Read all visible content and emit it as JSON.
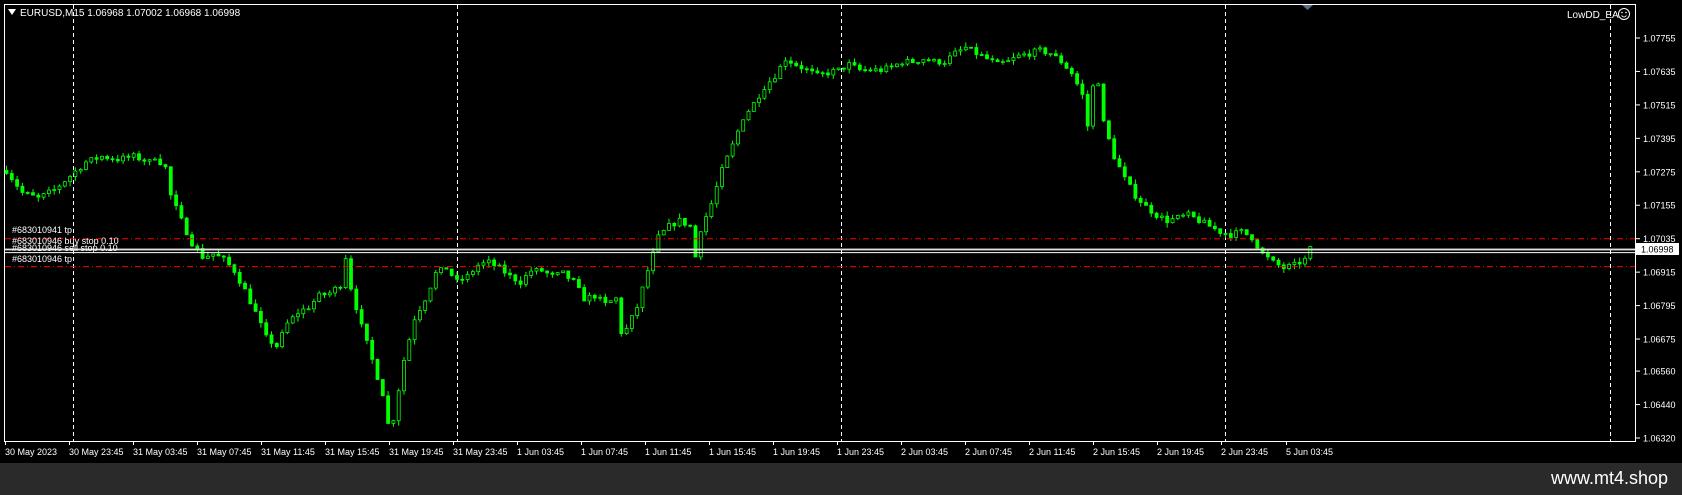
{
  "header": {
    "symbol_line": "EURUSD,M15  1.06968 1.07002 1.06968 1.06998",
    "ea_label": "LowDD_EA"
  },
  "icons": {
    "dropdown": "triangle-down-icon",
    "ea_face": "smiley-icon",
    "shift_marker": "triangle-down-icon"
  },
  "colors": {
    "background": "#000000",
    "candles": "#00ff00",
    "grid": "#ffffff",
    "order_lines": "#ff0000",
    "price_line": "#c0c0c0",
    "text": "#ffffff"
  },
  "orders": {
    "tp1": "#683010941 tp",
    "buy_stop": "#683010946 buy stop 0.10",
    "sell_stop": "#683010946 sell stop 0.10",
    "tp2": "#683010946 tp"
  },
  "current_price": "1.06998",
  "watermark": "www.mt4.shop",
  "chart_data": {
    "type": "candlestick",
    "symbol": "EURUSD",
    "timeframe": "M15",
    "ylim": [
      1.0632,
      1.07815
    ],
    "y_ticks": [
      "1.07755",
      "1.07635",
      "1.07515",
      "1.07395",
      "1.07275",
      "1.07155",
      "1.07035",
      "1.06915",
      "1.06795",
      "1.06675",
      "1.06560",
      "1.06440",
      "1.06320"
    ],
    "x_ticks": [
      "30 May 2023",
      "30 May 23:45",
      "31 May 03:45",
      "31 May 07:45",
      "31 May 11:45",
      "31 May 15:45",
      "31 May 19:45",
      "31 May 23:45",
      "1 Jun 03:45",
      "1 Jun 07:45",
      "1 Jun 11:45",
      "1 Jun 15:45",
      "1 Jun 19:45",
      "1 Jun 23:45",
      "2 Jun 03:45",
      "2 Jun 07:45",
      "2 Jun 11:45",
      "2 Jun 15:45",
      "2 Jun 19:45",
      "2 Jun 23:45",
      "5 Jun 03:45"
    ],
    "order_levels": [
      1.07035,
      1.06995,
      1.06985,
      1.06935
    ],
    "close_path": [
      [
        0,
        1.0728
      ],
      [
        3,
        1.072
      ],
      [
        6,
        1.0718
      ],
      [
        9,
        1.0721
      ],
      [
        12,
        1.0726
      ],
      [
        15,
        1.0731
      ],
      [
        18,
        1.0733
      ],
      [
        21,
        1.0732
      ],
      [
        24,
        1.0733
      ],
      [
        27,
        1.0731
      ],
      [
        28,
        1.0733
      ],
      [
        30,
        1.0729
      ],
      [
        31,
        1.0719
      ],
      [
        33,
        1.071
      ],
      [
        35,
        1.0702
      ],
      [
        37,
        1.0697
      ],
      [
        39,
        1.0698
      ],
      [
        41,
        1.0696
      ],
      [
        43,
        1.0692
      ],
      [
        45,
        1.0685
      ],
      [
        47,
        1.0677
      ],
      [
        49,
        1.0668
      ],
      [
        51,
        1.0665
      ],
      [
        53,
        1.0673
      ],
      [
        55,
        1.0677
      ],
      [
        57,
        1.0679
      ],
      [
        59,
        1.0683
      ],
      [
        61,
        1.0684
      ],
      [
        63,
        1.0687
      ],
      [
        64,
        1.0697
      ],
      [
        65,
        1.0686
      ],
      [
        67,
        1.0672
      ],
      [
        69,
        1.066
      ],
      [
        71,
        1.0648
      ],
      [
        72,
        1.0637
      ],
      [
        73,
        1.0639
      ],
      [
        75,
        1.066
      ],
      [
        77,
        1.0675
      ],
      [
        79,
        1.0682
      ],
      [
        81,
        1.0691
      ],
      [
        83,
        1.0693
      ],
      [
        85,
        1.0688
      ],
      [
        87,
        1.069
      ],
      [
        89,
        1.0694
      ],
      [
        91,
        1.0695
      ],
      [
        93,
        1.0693
      ],
      [
        95,
        1.069
      ],
      [
        97,
        1.0688
      ],
      [
        99,
        1.0692
      ],
      [
        101,
        1.0692
      ],
      [
        103,
        1.069
      ],
      [
        105,
        1.0691
      ],
      [
        107,
        1.0688
      ],
      [
        109,
        1.0682
      ],
      [
        111,
        1.0683
      ],
      [
        113,
        1.068
      ],
      [
        115,
        1.0682
      ],
      [
        116,
        1.067
      ],
      [
        117,
        1.0671
      ],
      [
        119,
        1.0679
      ],
      [
        121,
        1.0692
      ],
      [
        123,
        1.0704
      ],
      [
        125,
        1.0708
      ],
      [
        127,
        1.071
      ],
      [
        129,
        1.0708
      ],
      [
        130,
        1.0697
      ],
      [
        131,
        1.0707
      ],
      [
        133,
        1.0716
      ],
      [
        135,
        1.0728
      ],
      [
        137,
        1.0737
      ],
      [
        139,
        1.0747
      ],
      [
        141,
        1.0752
      ],
      [
        143,
        1.0758
      ],
      [
        145,
        1.0762
      ],
      [
        147,
        1.0768
      ],
      [
        149,
        1.0766
      ],
      [
        151,
        1.0764
      ],
      [
        153,
        1.0762
      ],
      [
        155,
        1.0763
      ],
      [
        157,
        1.0764
      ],
      [
        159,
        1.0766
      ],
      [
        161,
        1.0764
      ],
      [
        163,
        1.0764
      ],
      [
        165,
        1.0764
      ],
      [
        167,
        1.0765
      ],
      [
        169,
        1.0767
      ],
      [
        171,
        1.0767
      ],
      [
        173,
        1.0768
      ],
      [
        175,
        1.0767
      ],
      [
        177,
        1.0767
      ],
      [
        179,
        1.077
      ],
      [
        181,
        1.0772
      ],
      [
        183,
        1.077
      ],
      [
        185,
        1.0768
      ],
      [
        187,
        1.0766
      ],
      [
        189,
        1.0767
      ],
      [
        191,
        1.0769
      ],
      [
        193,
        1.077
      ],
      [
        195,
        1.0771
      ],
      [
        197,
        1.077
      ],
      [
        199,
        1.0767
      ],
      [
        201,
        1.0763
      ],
      [
        203,
        1.0755
      ],
      [
        204,
        1.0744
      ],
      [
        205,
        1.0758
      ],
      [
        206,
        1.076
      ],
      [
        207,
        1.0745
      ],
      [
        209,
        1.0733
      ],
      [
        211,
        1.0725
      ],
      [
        213,
        1.0719
      ],
      [
        215,
        1.0715
      ],
      [
        217,
        1.0712
      ],
      [
        219,
        1.071
      ],
      [
        221,
        1.0711
      ],
      [
        223,
        1.0712
      ],
      [
        225,
        1.071
      ],
      [
        227,
        1.0708
      ],
      [
        229,
        1.0706
      ],
      [
        231,
        1.0705
      ],
      [
        233,
        1.0706
      ],
      [
        235,
        1.0704
      ],
      [
        237,
        1.0698
      ],
      [
        239,
        1.0695
      ],
      [
        241,
        1.0693
      ],
      [
        243,
        1.0694
      ],
      [
        245,
        1.0696
      ],
      [
        246,
        1.06998
      ]
    ]
  }
}
